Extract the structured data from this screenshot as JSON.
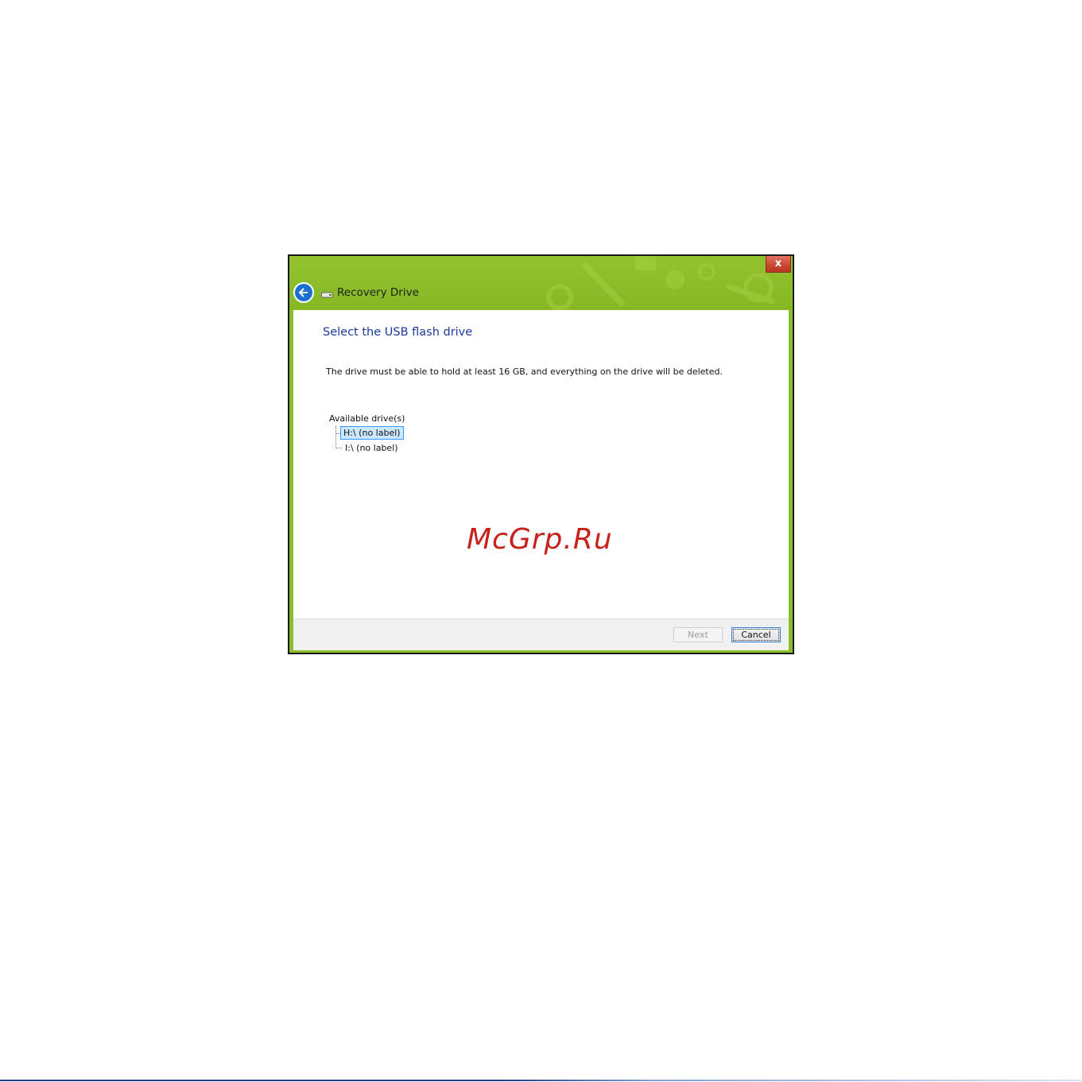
{
  "window": {
    "title": "Recovery Drive",
    "close_label": "x",
    "accent_color": "#8cbd2b"
  },
  "icons": {
    "back": "back-arrow-icon",
    "drive": "drive-icon",
    "close": "close-icon"
  },
  "content": {
    "heading": "Select the USB flash drive",
    "description": "The drive must be able to hold at least 16 GB, and everything on the drive will be deleted.",
    "tree_label": "Available drive(s)",
    "drives": [
      {
        "label": "H:\\ (no label)",
        "selected": true
      },
      {
        "label": "I:\\ (no label)",
        "selected": false
      }
    ]
  },
  "watermark": "McGrp.Ru",
  "footer": {
    "next_label": "Next",
    "cancel_label": "Cancel",
    "next_enabled": false
  }
}
